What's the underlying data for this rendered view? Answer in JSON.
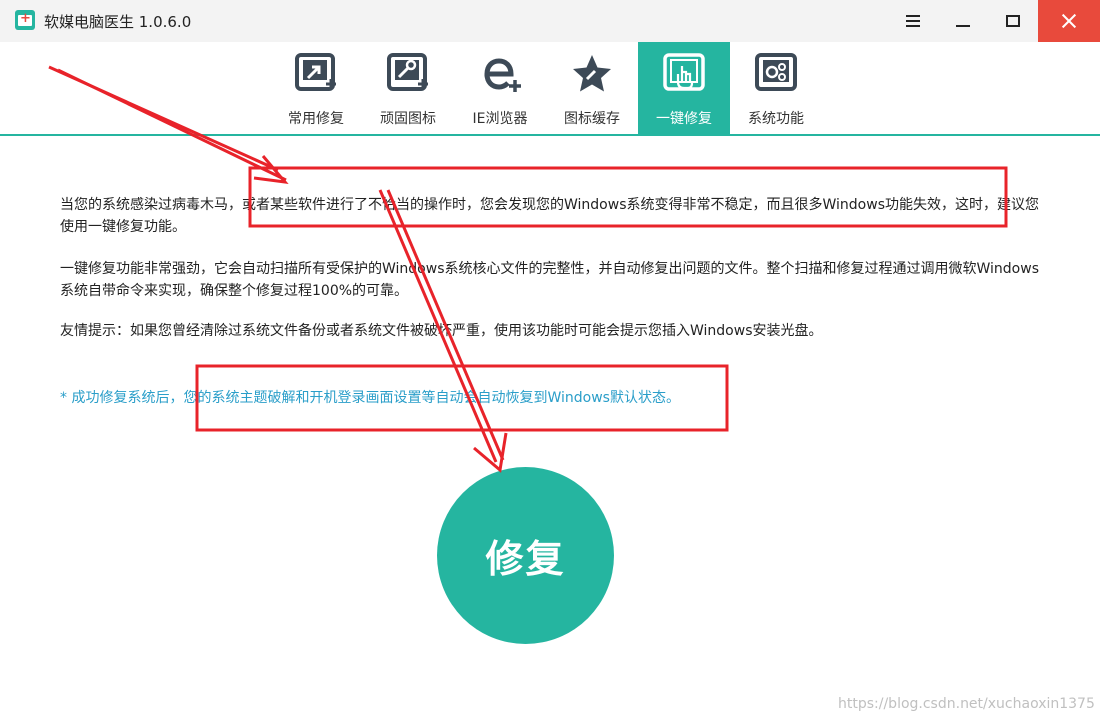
{
  "window": {
    "title": "软媒电脑医生 1.0.6.0",
    "controls": {
      "menu": "menu-icon",
      "minimize": "minimize-icon",
      "maximize": "maximize-icon",
      "close": "close-icon"
    }
  },
  "tabs": [
    {
      "label": "常用修复",
      "icon": "common-repair-icon",
      "active": false
    },
    {
      "label": "顽固图标",
      "icon": "stubborn-icon-tool-icon",
      "active": false
    },
    {
      "label": "IE浏览器",
      "icon": "ie-browser-icon",
      "active": false
    },
    {
      "label": "图标缓存",
      "icon": "icon-cache-star-icon",
      "active": false
    },
    {
      "label": "一键修复",
      "icon": "one-click-repair-icon",
      "active": true
    },
    {
      "label": "系统功能",
      "icon": "system-function-gears-icon",
      "active": false
    }
  ],
  "content": {
    "para1": "当您的系统感染过病毒木马，或者某些软件进行了不恰当的操作时，您会发现您的Windows系统变得非常不稳定，而且很多Windows功能失效，这时，建议您使用一键修复功能。",
    "para2": "一键修复功能非常强劲，它会自动扫描所有受保护的Windows系统核心文件的完整性，并自动修复出问题的文件。整个扫描和修复过程通过调用微软Windows系统自带命令来实现，确保整个修复过程100%的可靠。",
    "para3": "友情提示：如果您曾经清除过系统文件备份或者系统文件被破坏严重，使用该功能时可能会提示您插入Windows安装光盘。",
    "note": "* 成功修复系统后，您的系统主题破解和开机登录画面设置等自动会自动恢复到Windows默认状态。"
  },
  "repair_button": {
    "label": "修复"
  },
  "watermark": "https://blog.csdn.net/xuchaoxin1375",
  "colors": {
    "accent": "#25b5a0",
    "close": "#e84a3c",
    "note": "#2a9ec9",
    "annotation": "#e8232a"
  }
}
